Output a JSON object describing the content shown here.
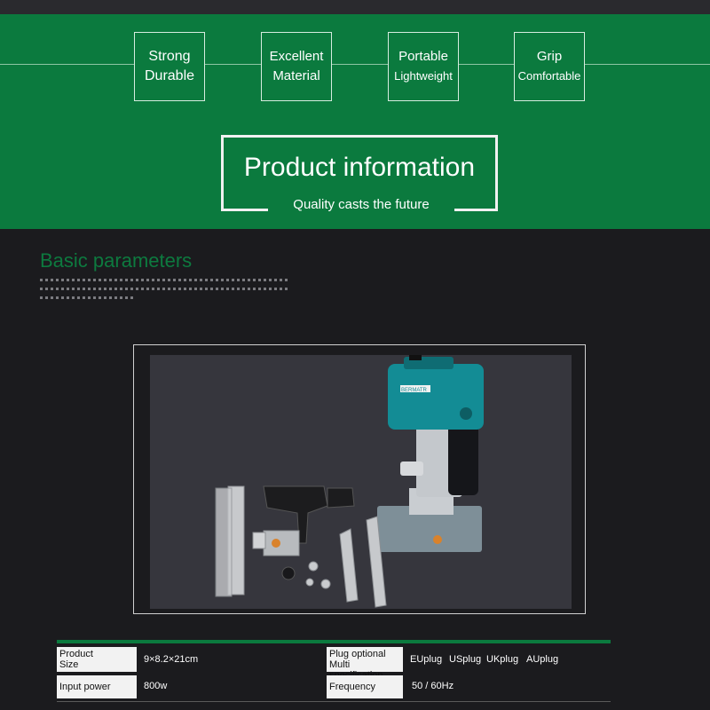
{
  "features": [
    {
      "line1": "Strong",
      "line2": "Durable"
    },
    {
      "line1": "Excellent",
      "line2": "Material"
    },
    {
      "line1": "Portable",
      "line2": "Lightweight"
    },
    {
      "line1": "Grip",
      "line2": "Comfortable"
    }
  ],
  "product_info": {
    "title": "Product information",
    "subtitle": "Quality casts the future"
  },
  "basic": {
    "title": "Basic parameters"
  },
  "product_image": {
    "brand_label": "BERMATR"
  },
  "specs": {
    "size_label_1": "Product",
    "size_label_2": "Size",
    "size_value": "9×8.2×21cm",
    "plug_label_1": "Plug optional",
    "plug_label_2": "Multi specification",
    "plugs": [
      "EUplug",
      "USplug",
      "UKplug",
      "AUplug"
    ],
    "power_label": "Input power",
    "power_value": "800w",
    "freq_label": "Frequency",
    "freq_value": "50 / 60Hz"
  }
}
